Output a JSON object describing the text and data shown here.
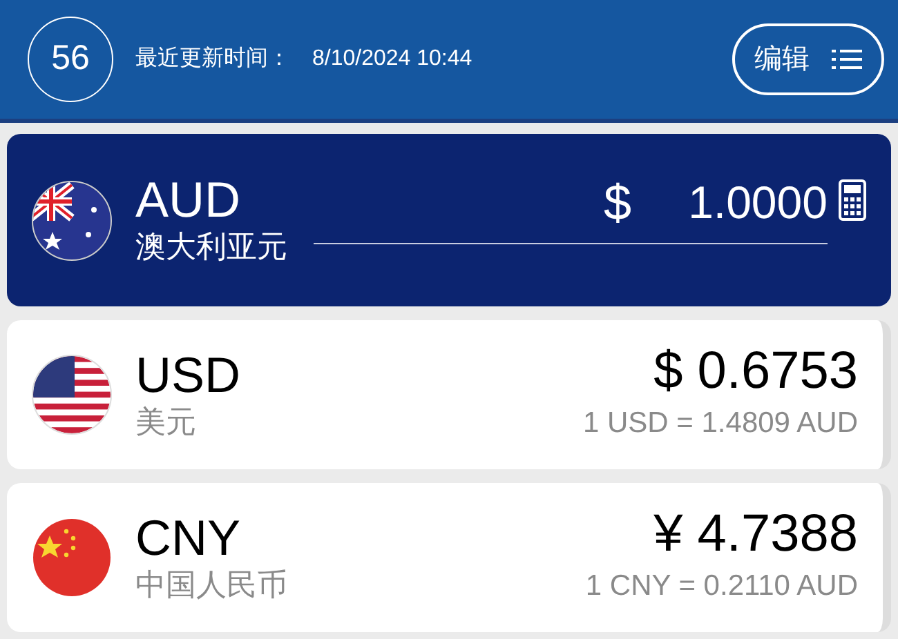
{
  "header": {
    "countdown": "56",
    "updated_label": "最近更新时间：",
    "updated_time": "8/10/2024 10:44",
    "edit_button": "编辑"
  },
  "currencies": [
    {
      "code": "AUD",
      "name": "澳大利亚元",
      "selected": true,
      "symbol": "$",
      "value": "1.0000"
    },
    {
      "code": "USD",
      "name": "美元",
      "selected": false,
      "amount": "$ 0.6753",
      "rate": "1 USD = 1.4809 AUD"
    },
    {
      "code": "CNY",
      "name": "中国人民币",
      "selected": false,
      "amount": "¥ 4.7388",
      "rate": "1 CNY = 0.2110 AUD"
    }
  ]
}
